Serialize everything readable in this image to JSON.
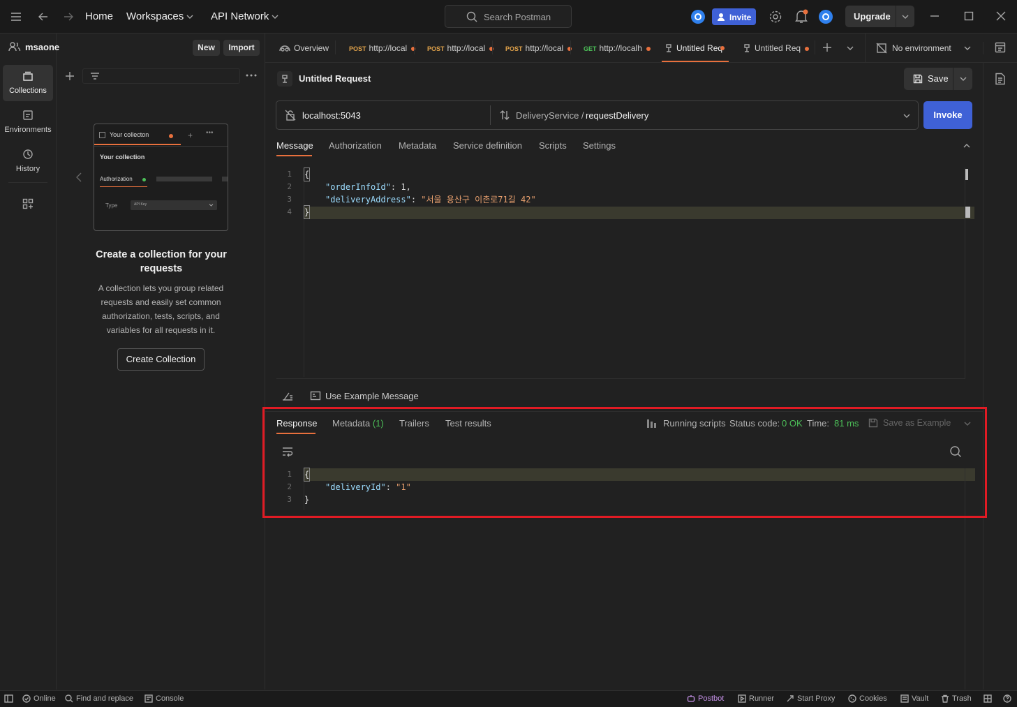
{
  "header": {
    "nav": [
      "Home",
      "Workspaces",
      "API Network"
    ],
    "search_placeholder": "Search Postman",
    "invite_label": "Invite",
    "upgrade_label": "Upgrade"
  },
  "workspace": {
    "name": "msaone",
    "new_label": "New",
    "import_label": "Import"
  },
  "rail": [
    {
      "label": "Collections",
      "icon": "collections-icon"
    },
    {
      "label": "Environments",
      "icon": "environments-icon"
    },
    {
      "label": "History",
      "icon": "history-icon"
    }
  ],
  "empty_state": {
    "preview_tab": "Your collecton",
    "preview_title": "Your collection",
    "preview_auth": "Authorization",
    "preview_type": "Type",
    "preview_type_value": "API Key",
    "title": "Create a collection for your requests",
    "description": "A collection lets you group related requests and easily set common authorization, tests, scripts, and variables for all requests in it.",
    "button": "Create Collection"
  },
  "tabs": [
    {
      "method": "",
      "label": "Overview"
    },
    {
      "method": "POST",
      "label": "http://local"
    },
    {
      "method": "POST",
      "label": "http://local"
    },
    {
      "method": "POST",
      "label": "http://local"
    },
    {
      "method": "GET",
      "label": "http://localh"
    },
    {
      "method": "",
      "label": "Untitled Req"
    },
    {
      "method": "",
      "label": "Untitled Req"
    }
  ],
  "environment": "No environment",
  "request": {
    "title": "Untitled Request",
    "save_label": "Save",
    "url": "localhost:5043",
    "service": "DeliveryService /",
    "method_name": "requestDelivery",
    "invoke_label": "Invoke",
    "tabs": [
      "Message",
      "Authorization",
      "Metadata",
      "Service definition",
      "Scripts",
      "Settings"
    ],
    "message_lines": {
      "l1": "{",
      "k2": "\"orderInfoId\"",
      "v2": " 1,",
      "k3": "\"deliveryAddress\"",
      "v3": "\"서울 용산구 이촌로71길 42\"",
      "l4": "}"
    },
    "use_example": "Use Example Message"
  },
  "response": {
    "tabs": [
      "Response",
      "Metadata",
      "Trailers",
      "Test results"
    ],
    "metadata_count": "(1)",
    "running": "Running scripts",
    "status_label": "Status code:",
    "status_value": "0 OK",
    "time_label": "Time:",
    "time_value": "81 ms",
    "save_example": "Save as Example",
    "lines": {
      "l1": "{",
      "k2": "\"deliveryId\"",
      "v2": "\"1\"",
      "l3": "}"
    }
  },
  "footer": {
    "online": "Online",
    "find": "Find and replace",
    "console": "Console",
    "postbot": "Postbot",
    "runner": "Runner",
    "proxy": "Start Proxy",
    "cookies": "Cookies",
    "vault": "Vault",
    "trash": "Trash"
  },
  "colors": {
    "accent": "#e8703d",
    "primary": "#3f61d6",
    "ok": "#4cbf58",
    "highlight": "#e01b24"
  }
}
